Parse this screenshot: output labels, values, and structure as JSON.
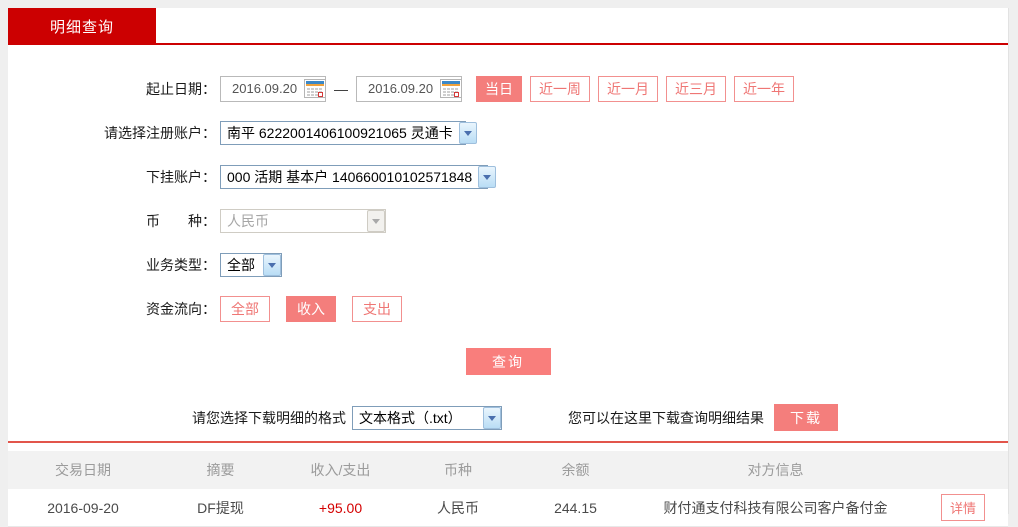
{
  "tab": {
    "label": "明细查询"
  },
  "form": {
    "date_range": {
      "label": "起止日期：",
      "start": "2016.09.20",
      "end": "2016.09.20",
      "separator": "—",
      "quick_buttons": [
        {
          "label": "当日"
        },
        {
          "label": "近一周"
        },
        {
          "label": "近一月"
        },
        {
          "label": "近三月"
        },
        {
          "label": "近一年"
        }
      ]
    },
    "registered_account": {
      "label": "请选择注册账户：",
      "value": "南平 6222001406100921065 灵通卡"
    },
    "sub_account": {
      "label": "下挂账户：",
      "value": "000 活期 基本户 140660010102571848"
    },
    "currency": {
      "label": "币　　种：",
      "value": "人民币"
    },
    "business_type": {
      "label": "业务类型：",
      "value": "全部"
    },
    "fund_flow": {
      "label": "资金流向：",
      "options": [
        {
          "label": "全部"
        },
        {
          "label": "收入"
        },
        {
          "label": "支出"
        }
      ]
    },
    "query_button": "查询"
  },
  "download": {
    "format_label": "请您选择下载明细的格式",
    "format_value": "文本格式（.txt）",
    "hint": "您可以在这里下载查询明细结果",
    "button": "下载"
  },
  "table": {
    "headers": [
      "交易日期",
      "摘要",
      "收入/支出",
      "币种",
      "余额",
      "对方信息"
    ],
    "rows": [
      {
        "date": "2016-09-20",
        "summary": "DF提现",
        "amount": "+95.00",
        "currency": "人民币",
        "balance": "244.15",
        "counterparty": "财付通支付科技有限公司客户备付金",
        "detail_button": "详情"
      }
    ]
  },
  "colors": {
    "brand_red": "#cc0001",
    "accent_salmon": "#f47e7c",
    "separator_red": "#e2554b",
    "amount_red": "#d40000"
  }
}
